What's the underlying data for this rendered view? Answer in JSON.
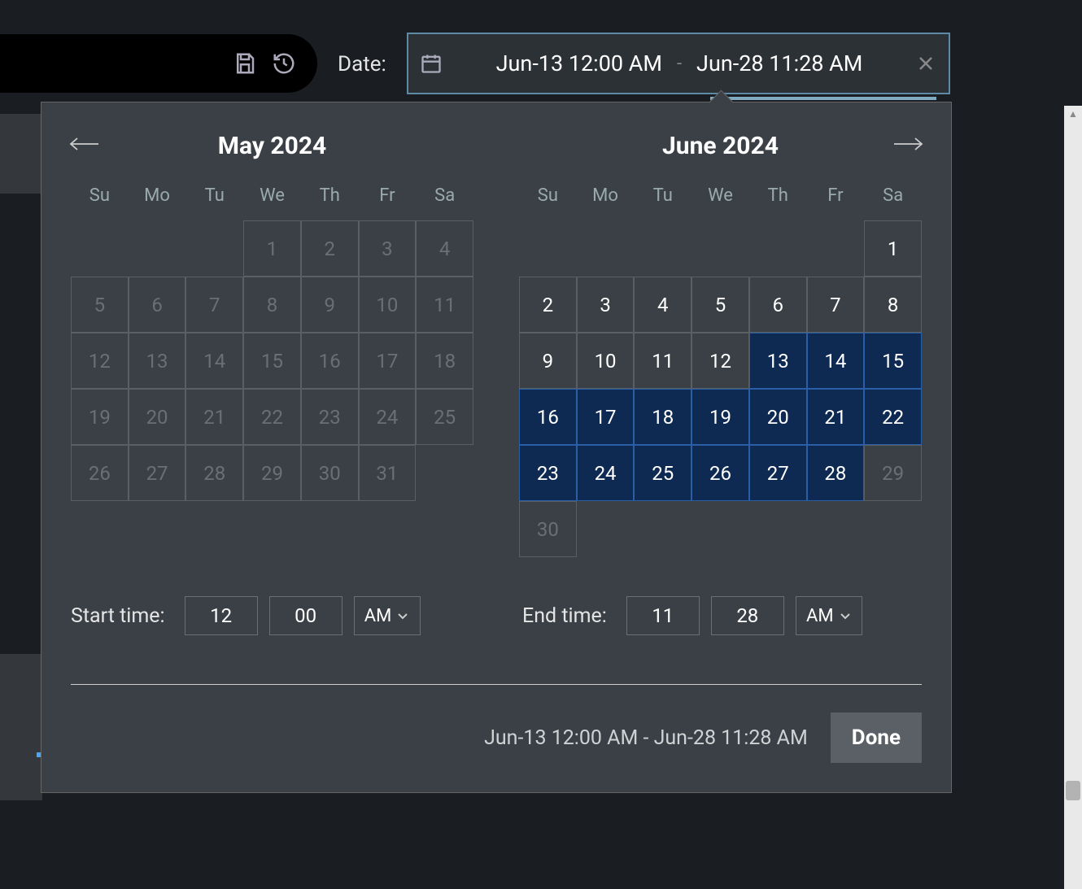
{
  "toolbar": {
    "date_label": "Date:"
  },
  "date_field": {
    "start_display": "Jun-13 12:00 AM",
    "end_display": "Jun-28 11:28 AM",
    "dash": "-"
  },
  "calendar": {
    "weekdays": [
      "Su",
      "Mo",
      "Tu",
      "We",
      "Th",
      "Fr",
      "Sa"
    ],
    "left": {
      "title": "May 2024",
      "lead_blanks": 3,
      "last_day": 31,
      "sel_start": 0,
      "sel_end": -1
    },
    "right": {
      "title": "June 2024",
      "lead_blanks": 6,
      "last_day": 30,
      "sel_start": 13,
      "sel_end": 28,
      "disabled_after": 28
    }
  },
  "time": {
    "start_label": "Start time:",
    "start_hour": "12",
    "start_min": "00",
    "start_ampm": "AM",
    "end_label": "End time:",
    "end_hour": "11",
    "end_min": "28",
    "end_ampm": "AM"
  },
  "footer": {
    "summary": "Jun-13 12:00 AM - Jun-28 11:28 AM",
    "done": "Done"
  }
}
